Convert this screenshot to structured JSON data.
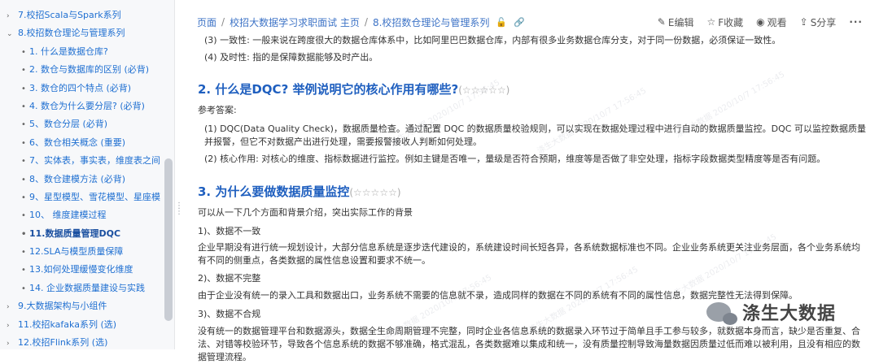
{
  "sidebar": {
    "items": [
      {
        "label": "7.校招Scala与Spark系列",
        "level": 1,
        "chevron": "›",
        "bullet": "•"
      },
      {
        "label": "8.校招数仓理论与管理系列",
        "level": 1,
        "chevron": "⌄"
      },
      {
        "label": "1. 什么是数据仓库?",
        "level": 2,
        "bullet": "•"
      },
      {
        "label": "2. 数仓与数据库的区别 (必背)",
        "level": 2,
        "bullet": "•"
      },
      {
        "label": "3. 数仓的四个特点 (必背)",
        "level": 2,
        "bullet": "•"
      },
      {
        "label": "4. 数仓为什么要分层? (必背)",
        "level": 2,
        "bullet": "•"
      },
      {
        "label": "5、数仓分层 (必背)",
        "level": 2,
        "bullet": "•"
      },
      {
        "label": "6、数仓相关概念 (重要)",
        "level": 2,
        "bullet": "•"
      },
      {
        "label": "7、实体表，事实表，维度表之间",
        "level": 2,
        "bullet": "•"
      },
      {
        "label": "8、数仓建模方法 (必背)",
        "level": 2,
        "bullet": "•"
      },
      {
        "label": "9、星型模型、雪花模型、星座模",
        "level": 2,
        "bullet": "•"
      },
      {
        "label": "10、 维度建模过程",
        "level": 2,
        "bullet": "•"
      },
      {
        "label": "11.数据质量管理DQC",
        "level": 2,
        "bullet": "•",
        "active": true
      },
      {
        "label": "12.SLA与模型质量保障",
        "level": 2,
        "bullet": "•"
      },
      {
        "label": "13.如何处理缓慢变化维度",
        "level": 2,
        "bullet": "•"
      },
      {
        "label": "14. 企业数据质量建设与实践",
        "level": 2,
        "bullet": "•"
      },
      {
        "label": "9.大数据架构与小组件",
        "level": 1,
        "chevron": "›"
      },
      {
        "label": "11.校招kafaka系列 (选)",
        "level": 1,
        "chevron": "›"
      },
      {
        "label": "12.校招Flink系列 (选)",
        "level": 1,
        "chevron": "›"
      }
    ]
  },
  "header": {
    "breadcrumbs": [
      "页面",
      "校招大数据学习求职面试 主页",
      "8.校招数仓理论与管理系列"
    ],
    "separator": "/",
    "lock_glyph": "🔓",
    "attach_glyph": "🔗",
    "actions": [
      {
        "icon": "✎",
        "label": "E编辑"
      },
      {
        "icon": "☆",
        "label": "F收藏"
      },
      {
        "icon": "◉",
        "label": "观看"
      },
      {
        "icon": "⇪",
        "label": "S分享"
      }
    ],
    "more": "···"
  },
  "content": {
    "top1": "(3) 一致性: 一般来说在跨度很大的数据仓库体系中，比如阿里巴巴数据仓库，内部有很多业务数据仓库分支，对于同一份数据，必须保证一致性。",
    "top2": "(4) 及时性: 指的是保障数据能够及时产出。",
    "h2": "2. 什么是DQC? 举例说明它的核心作用有哪些?",
    "h2_stars": "(☆☆☆☆☆)",
    "ref": "参考答案:",
    "p1": "(1) DQC(Data Quality Check)，数据质量检查。通过配置 DQC 的数据质量校验规则，可以实现在数据处理过程中进行自动的数据质量监控。DQC 可以监控数据质量并报警，但它不对数据产出进行处理，需要报警接收人判断如何处理。",
    "p2": "(2) 核心作用: 对核心的维度、指标数据进行监控。例如主键是否唯一，量级是否符合预期，维度等是否做了非空处理，指标字段数据类型精度等是否有问题。",
    "h3": "3. 为什么要做数据质量监控",
    "h3_stars": "(☆☆☆☆☆)",
    "intro": "可以从一下几个方面和背景介绍，突出实际工作的背景",
    "s1": "1)、数据不一致",
    "s1_text": "企业早期没有进行统一规划设计，大部分信息系统是逐步迭代建设的，系统建设时间长短各异，各系统数据标准也不同。企业业务系统更关注业务层面，各个业务系统均有不同的侧重点，各类数据的属性信息设置和要求不统一。",
    "s2": "2)、数据不完整",
    "s2_text": "由于企业没有统一的录入工具和数据出口，业务系统不需要的信息就不录，造成同样的数据在不同的系统有不同的属性信息，数据完整性无法得到保障。",
    "s3": "3)、数据不合规",
    "s3_text": "没有统一的数据管理平台和数据源头，数据全生命周期管理不完整，同时企业各信息系统的数据录入环节过于简单且手工参与较多，就数据本身而言，缺少是否重复、合法、对错等校验环节，导致各个信息系统的数据不够准确，格式混乱，各类数据难以集成和统一，没有质量控制导致海量数据因质量过低而难以被利用，且没有相应的数据管理流程。"
  },
  "watermark": "涤生大数据 2020/10/7 17:56:45",
  "wechat": {
    "brand": "涤生大数据"
  }
}
